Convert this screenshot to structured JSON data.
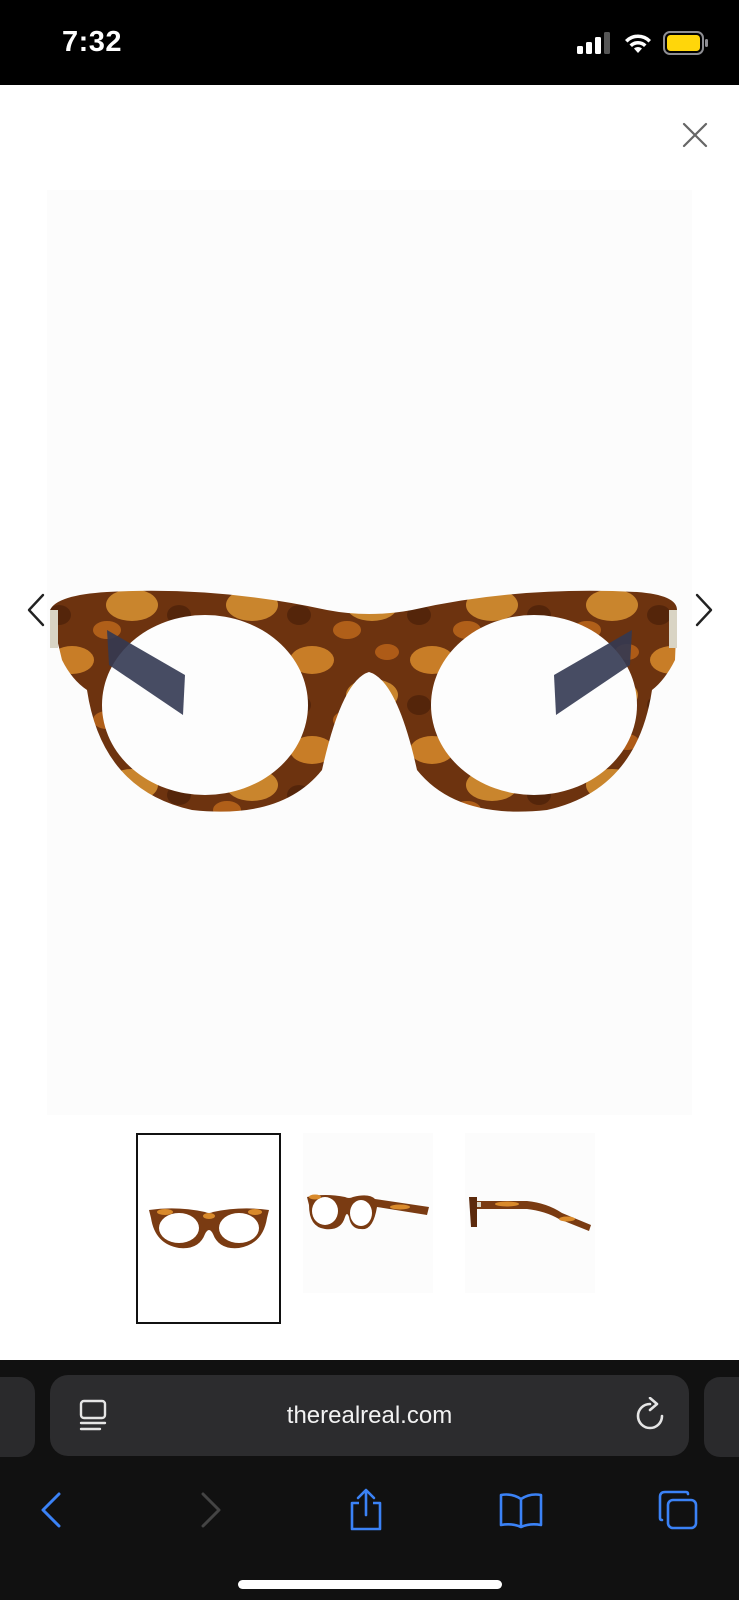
{
  "status": {
    "time": "7:32",
    "battery_color": "#FFD60A",
    "icons": [
      "cellular-signal-icon",
      "wifi-icon",
      "battery-icon"
    ]
  },
  "viewer": {
    "close_icon": "close-icon",
    "prev_icon": "chevron-left-icon",
    "next_icon": "chevron-right-icon",
    "main_image": "tortoiseshell-eyeglasses-front",
    "thumbnails": [
      {
        "view": "front",
        "selected": true
      },
      {
        "view": "three-quarter",
        "selected": false
      },
      {
        "view": "side",
        "selected": false
      }
    ]
  },
  "browser": {
    "url": "therealreal.com",
    "accent": "#3B82F6",
    "toolbar": [
      "back-icon",
      "forward-icon",
      "share-icon",
      "bookmarks-icon",
      "tabs-icon"
    ]
  }
}
